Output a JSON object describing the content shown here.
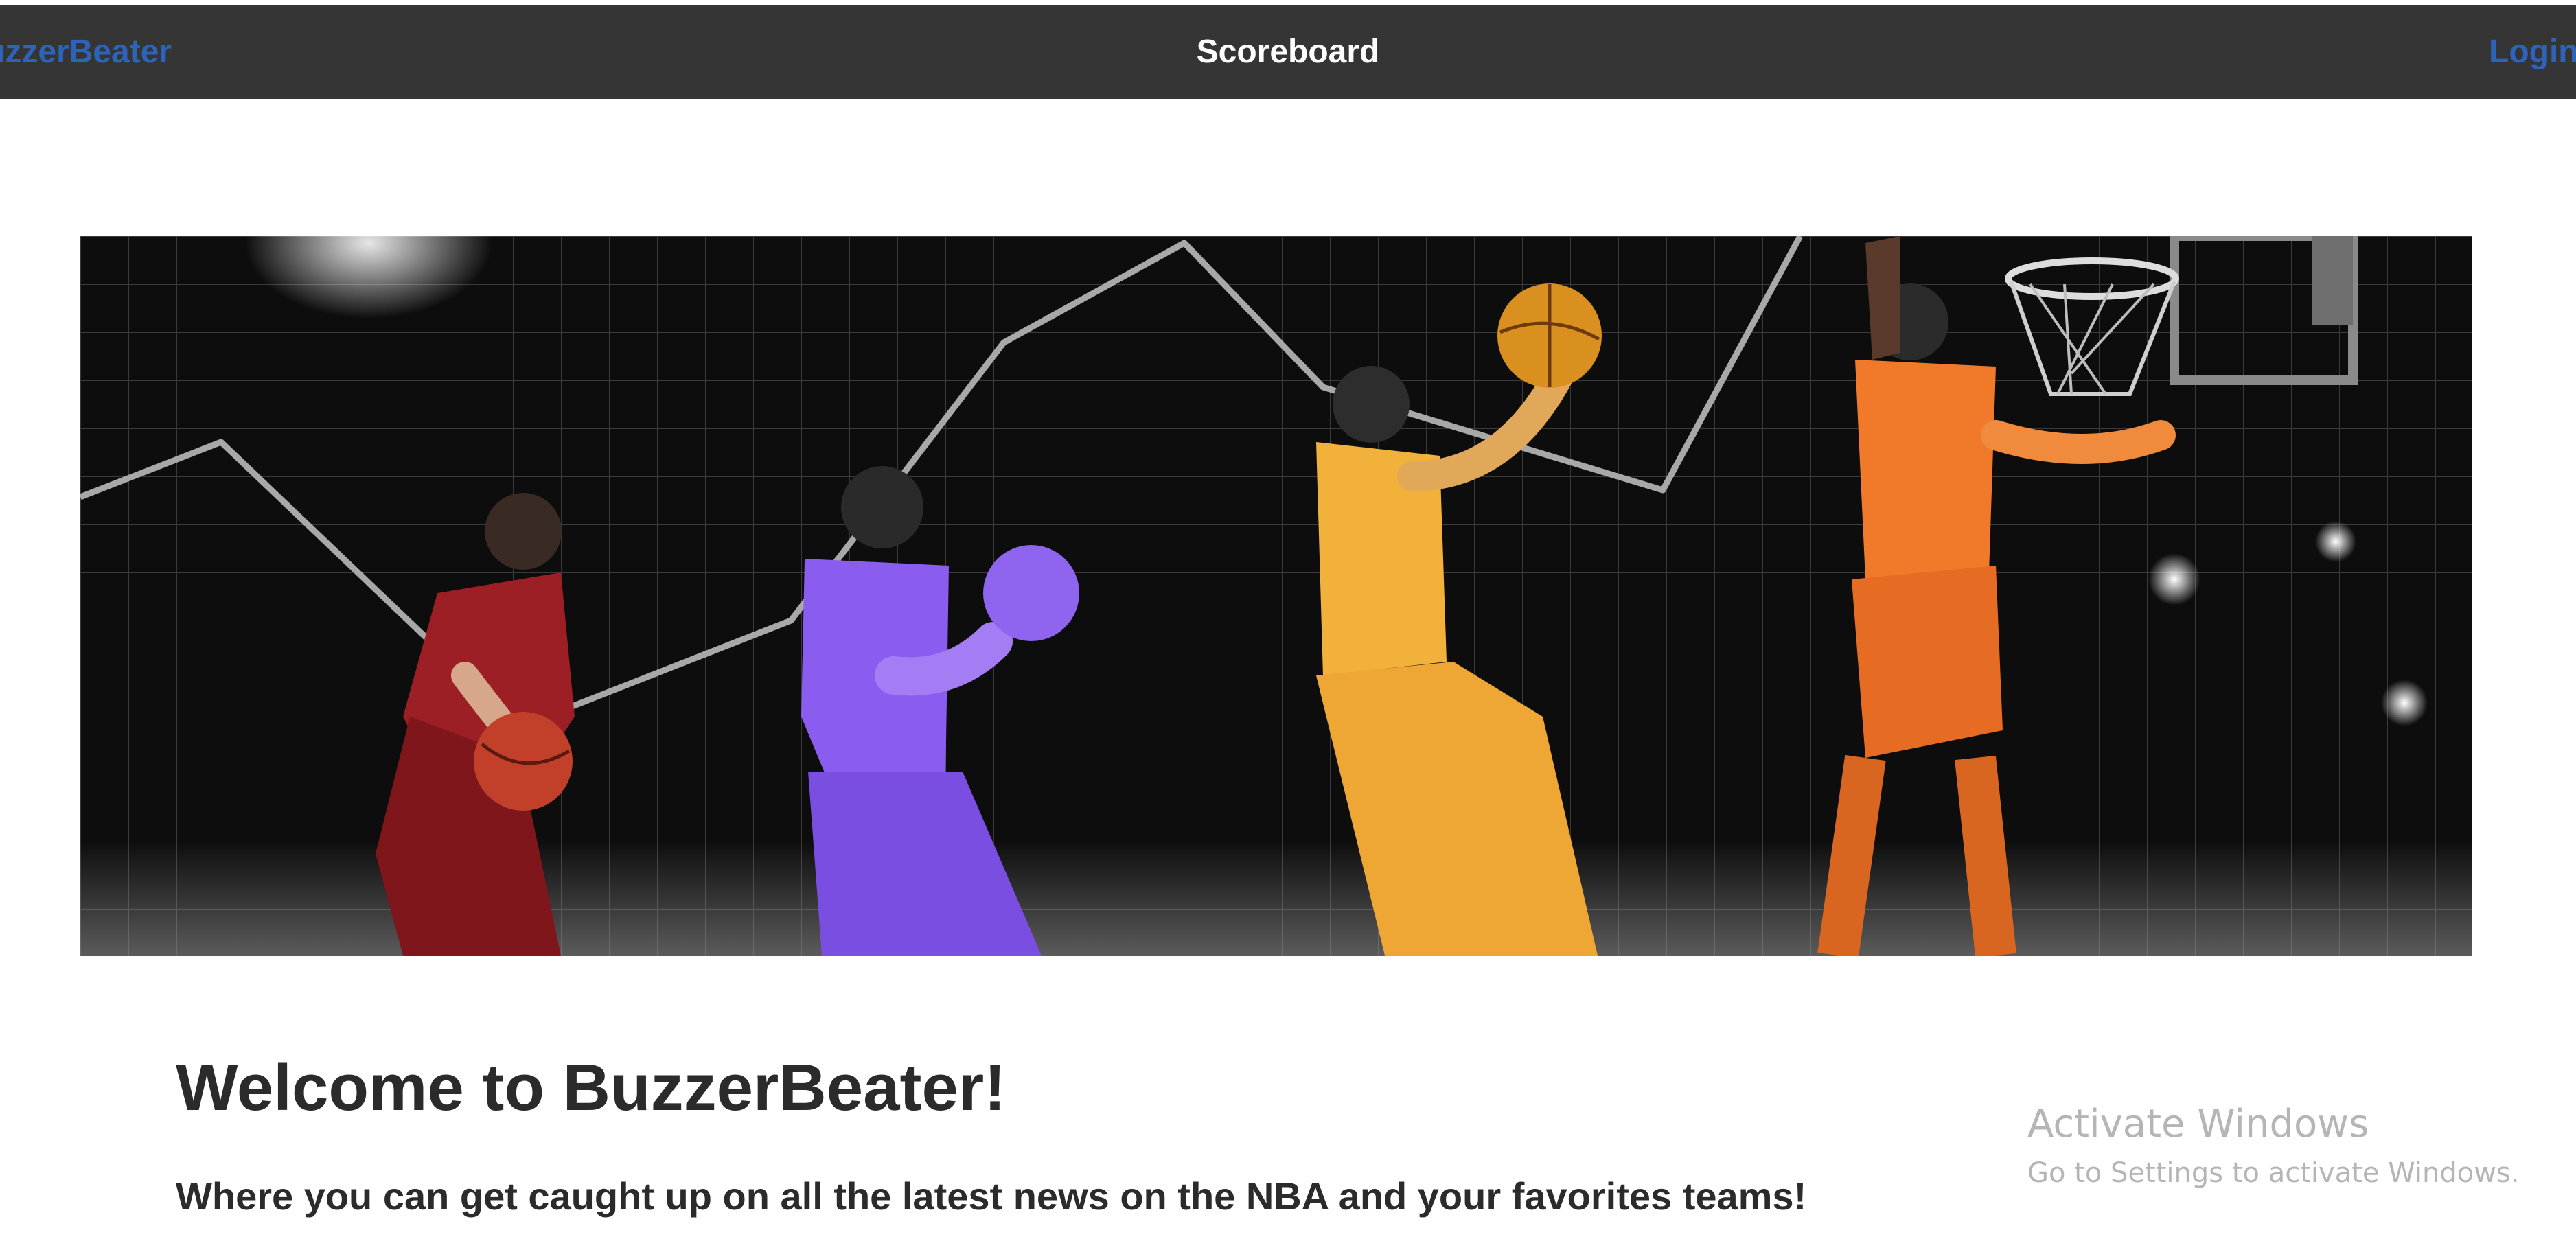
{
  "navbar": {
    "brand": "uzzerBeater",
    "title": "Scoreboard",
    "login": "Login"
  },
  "hero": {
    "image": "nba-players-banner"
  },
  "main": {
    "heading": "Welcome to BuzzerBeater!",
    "subheading": "Where you can get caught up on all the latest news on the NBA and your favorites teams!"
  },
  "watermark": {
    "title": "Activate Windows",
    "subtitle": "Go to Settings to activate Windows."
  },
  "colors": {
    "navbar_bg": "#353535",
    "link": "#2d63b8",
    "text": "#2b2b2b",
    "player_red": "#9b1f24",
    "player_purple": "#8a5cf0",
    "player_gold": "#f2b13a",
    "player_orange": "#f07a2a"
  }
}
